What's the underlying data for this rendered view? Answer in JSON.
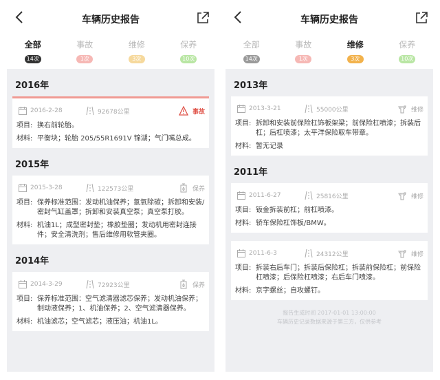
{
  "left": {
    "nav": {
      "title": "车辆历史报告"
    },
    "tabs": [
      {
        "label": "全部",
        "badge": "14次",
        "color": "#333333",
        "active": true
      },
      {
        "label": "事故",
        "badge": "1次",
        "color": "#f6b8b5",
        "active": false
      },
      {
        "label": "维修",
        "badge": "3次",
        "color": "#f6d99d",
        "active": false
      },
      {
        "label": "保养",
        "badge": "10次",
        "color": "#b9e6a4",
        "active": false
      }
    ],
    "sections": [
      {
        "year": "2016年",
        "cards": [
          {
            "date": "2016-2-28",
            "mileage": "92678公里",
            "kind": "事故",
            "item_key": "项目:",
            "item": "换右前轮胎。",
            "material_key": "材料:",
            "material": "平衡块；轮胎 205/55R1691V 锦湖；气门嘴总成。"
          }
        ]
      },
      {
        "year": "2015年",
        "cards": [
          {
            "date": "2015-3-28",
            "mileage": "122573公里",
            "kind": "保养",
            "item_key": "项目:",
            "item": "保养标准范围：发动机油保养；氢氧除碳；拆卸和安装/密封气缸盖罩；拆卸和安装真空泵；真空泵打胶。",
            "material_key": "材料:",
            "material": "机油1L；成型密封垫；橡胶垫圈；发动机用密封连接件；安全清洗剂；售后维修用软管夹圈。"
          }
        ]
      },
      {
        "year": "2014年",
        "cards": [
          {
            "date": "2014-3-29",
            "mileage": "72923公里",
            "kind": "保养",
            "item_key": "项目:",
            "item": "保养标准范围：空气滤清器滤芯保养；发动机油保养；制动液保养；1、机油保养；2、空气滤清器保养。",
            "material_key": "材料:",
            "material": "机油滤芯；空气滤芯；液压油；机油1L。"
          }
        ]
      }
    ]
  },
  "right": {
    "nav": {
      "title": "车辆历史报告"
    },
    "tabs": [
      {
        "label": "全部",
        "badge": "14次",
        "color": "#9a9a9a",
        "active": false
      },
      {
        "label": "事故",
        "badge": "1次",
        "color": "#f6b8b5",
        "active": false
      },
      {
        "label": "维修",
        "badge": "3次",
        "color": "#f2b24c",
        "active": true
      },
      {
        "label": "保养",
        "badge": "10次",
        "color": "#b9e6a4",
        "active": false
      }
    ],
    "sections": [
      {
        "year": "2013年",
        "cards": [
          {
            "date": "2013-3-21",
            "mileage": "55000公里",
            "kind": "维修",
            "item_key": "项目:",
            "item": "拆卸和安装前保险杠饰板架梁；前保险杠喷漆；拆装后杠；后杠喷漆；太平洋保险取车带章。",
            "material_key": "材料:",
            "material": "暂无记录"
          }
        ]
      },
      {
        "year": "2011年",
        "cards": [
          {
            "date": "2011-6-27",
            "mileage": "25816公里",
            "kind": "维修",
            "item_key": "项目:",
            "item": "钣金拆装前杠；前杠喷漆。",
            "material_key": "材料:",
            "material": "轿车保险杠饰板/BMW。"
          },
          {
            "date": "2011-6-3",
            "mileage": "24312公里",
            "kind": "维修",
            "item_key": "项目:",
            "item": "拆装右后车门；拆装后保险杠；拆装前保险杠；前保险杠喷漆；后保险杠喷漆；右后车门喷漆。",
            "material_key": "材料:",
            "material": "京字螺丝；自攻螺钉。"
          }
        ]
      }
    ],
    "footer": {
      "line1": "报告生成时间 2017-01-01 13:00:00",
      "line2": "车辆历史记录数据来源于第三方，仅供参考"
    }
  },
  "icons": {
    "back": "chevron-left-icon",
    "share": "share-icon",
    "calendar": "calendar-icon",
    "mileage": "road-icon",
    "accident": "warning-icon",
    "maintenance": "oil-can-icon",
    "repair": "wrench-icon"
  },
  "colors": {
    "accident_red": "#e0564c",
    "accident_border": "#f09a93",
    "panel_bg": "#eeeff2"
  }
}
